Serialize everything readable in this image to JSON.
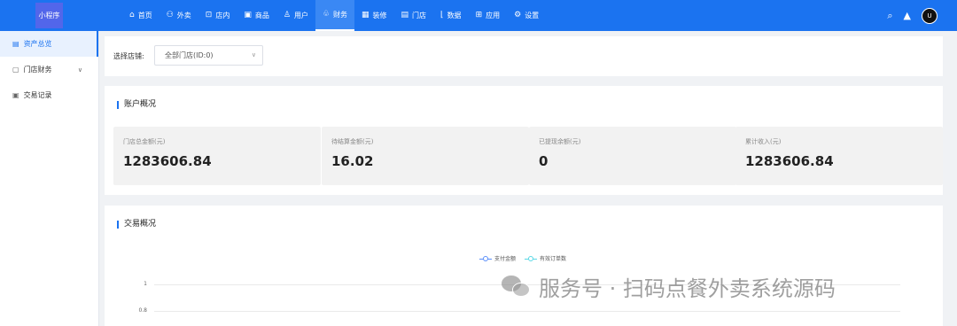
{
  "app": {
    "logo_text": "小程序"
  },
  "nav": [
    {
      "icon": "⌂",
      "label": "首页",
      "icon_name": "home-icon"
    },
    {
      "icon": "⚇",
      "label": "外卖",
      "icon_name": "delivery-icon"
    },
    {
      "icon": "⊡",
      "label": "店内",
      "icon_name": "store-icon"
    },
    {
      "icon": "▣",
      "label": "商品",
      "icon_name": "goods-icon"
    },
    {
      "icon": "♙",
      "label": "用户",
      "icon_name": "user-icon"
    },
    {
      "icon": "♧",
      "label": "财务",
      "icon_name": "finance-icon"
    },
    {
      "icon": "▦",
      "label": "装修",
      "icon_name": "decorate-icon"
    },
    {
      "icon": "▤",
      "label": "门店",
      "icon_name": "shop-icon"
    },
    {
      "icon": "⌊",
      "label": "数据",
      "icon_name": "data-icon"
    },
    {
      "icon": "⊞",
      "label": "应用",
      "icon_name": "apps-icon"
    },
    {
      "icon": "⚙",
      "label": "设置",
      "icon_name": "settings-icon"
    }
  ],
  "nav_active_index": 5,
  "top_right": {
    "avatar_text": "U"
  },
  "sidebar": [
    {
      "icon": "▤",
      "label": "资产总览",
      "active": true,
      "has_chevron": false
    },
    {
      "icon": "▢",
      "label": "门店财务",
      "active": false,
      "has_chevron": true
    },
    {
      "icon": "▣",
      "label": "交易记录",
      "active": false,
      "has_chevron": false
    }
  ],
  "filter": {
    "label": "选择店铺:",
    "selected": "全部门店(ID:0)"
  },
  "account": {
    "title": "账户概况",
    "stats": [
      {
        "label": "门店总金额(元)",
        "value": "1283606.84"
      },
      {
        "label": "待结算金额(元)",
        "value": "16.02"
      },
      {
        "label": "已提现余额(元)",
        "value": "0"
      },
      {
        "label": "累计收入(元)",
        "value": "1283606.84"
      }
    ]
  },
  "trade": {
    "title": "交易概况",
    "legend": [
      {
        "name": "支付金额",
        "color": "#5b8ff9"
      },
      {
        "name": "有效订单数",
        "color": "#5ad8e6"
      }
    ],
    "y_ticks": [
      "1",
      "0.8"
    ]
  },
  "watermark": {
    "text": "服务号 · 扫码点餐外卖系统源码"
  }
}
